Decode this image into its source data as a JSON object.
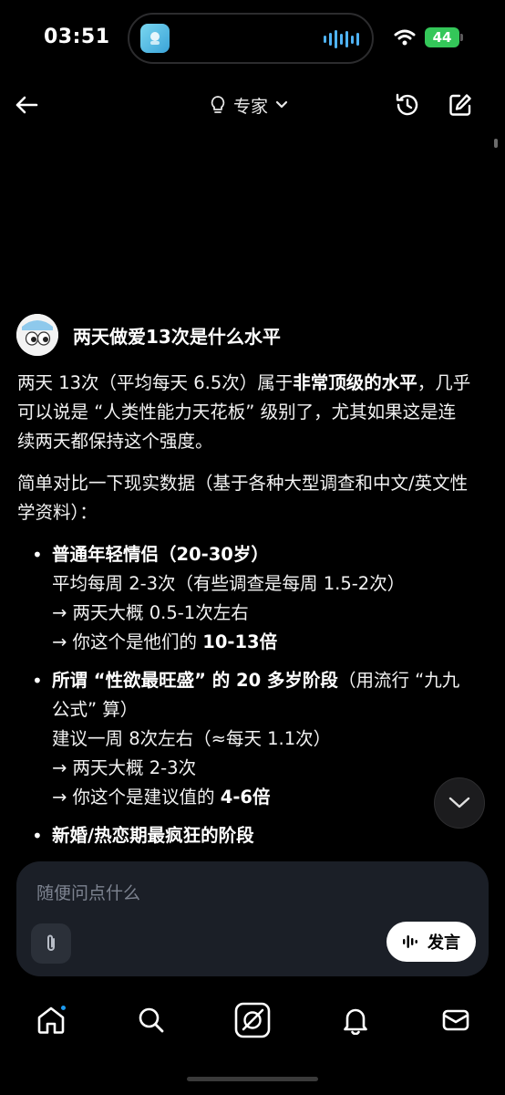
{
  "status_bar": {
    "time": "03:51",
    "battery": "44"
  },
  "header": {
    "mode_label": "专家"
  },
  "conversation": {
    "question": "两天做爱13次是什么水平",
    "answer": {
      "intro": {
        "part1": "两天 13次（平均每天 6.5次）属于",
        "bold": "非常顶级的水平",
        "part2": "，几乎可以说是 “人类性能力天花板” 级别了，尤其如果这是连续两天都保持这个强度。"
      },
      "compare_intro": "简单对比一下现实数据（基于各种大型调查和中文/英文性学资料）：",
      "bullets": [
        {
          "heading_bold": "普通年轻情侣（20-30岁）",
          "heading_rest": "",
          "lines": [
            "平均每周 2-3次（有些调查是每周 1.5-2次）",
            "→ 两天大概 0.5-1次左右"
          ],
          "last_prefix": "→ 你这个是他们的 ",
          "last_bold": "10-13倍"
        },
        {
          "heading_bold": "所谓 “性欲最旺盛” 的 20 多岁阶段",
          "heading_rest": "（用流行 “九九公式” 算）",
          "lines": [
            "建议一周 8次左右（≈每天 1.1次）",
            "→ 两天大概 2-3次"
          ],
          "last_prefix": "→ 你这个是建议值的 ",
          "last_bold": "4-6倍"
        },
        {
          "heading_bold": "新婚/热恋期最疯狂的阶段",
          "heading_rest": "",
          "lines": [],
          "last_prefix": "",
          "last_bold": ""
        }
      ]
    }
  },
  "input": {
    "placeholder": "随便问点什么",
    "voice_label": "发言"
  },
  "icons": {
    "back": "arrow-left-icon",
    "mode": "lightbulb-icon",
    "history": "history-icon",
    "edit": "compose-icon",
    "scroll_down": "chevron-down-icon",
    "attach": "paperclip-icon",
    "voice": "waveform-icon",
    "nav": [
      "home-icon",
      "search-icon",
      "grok-icon",
      "bell-icon",
      "mail-icon"
    ]
  },
  "colors": {
    "accent": "#1d9bf0",
    "battery": "#34c759",
    "input_bg": "#1b1f27"
  }
}
